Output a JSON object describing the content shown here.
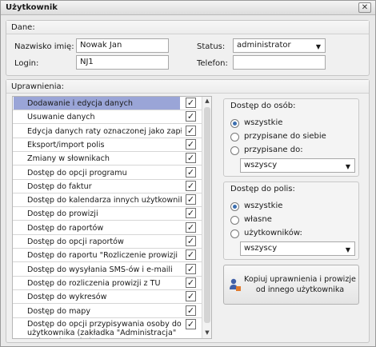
{
  "window": {
    "title": "Użytkownik",
    "close_glyph": "✕"
  },
  "dane": {
    "header": "Dane:",
    "name_label": "Nazwisko imię:",
    "name_value": "Nowak Jan",
    "login_label": "Login:",
    "login_value": "NJ1",
    "status_label": "Status:",
    "status_value": "administrator",
    "phone_label": "Telefon:",
    "phone_value": ""
  },
  "uprawnienia": {
    "header": "Uprawnienia:",
    "items": [
      {
        "label": "Dodawanie i edycja danych",
        "checked": true,
        "selected": true
      },
      {
        "label": "Usuwanie danych",
        "checked": true
      },
      {
        "label": "Edycja danych raty oznaczonej jako zapłacona",
        "checked": true
      },
      {
        "label": "Eksport/import polis",
        "checked": true
      },
      {
        "label": "Zmiany w słownikach",
        "checked": true
      },
      {
        "label": "Dostęp do opcji programu",
        "checked": true
      },
      {
        "label": "Dostęp do faktur",
        "checked": true
      },
      {
        "label": "Dostęp do kalendarza innych użytkowników",
        "checked": true
      },
      {
        "label": "Dostęp do prowizji",
        "checked": true
      },
      {
        "label": "Dostęp do raportów",
        "checked": true
      },
      {
        "label": "Dostęp do opcji raportów",
        "checked": true
      },
      {
        "label": "Dostęp do raportu \"Rozliczenie prowizji",
        "checked": true
      },
      {
        "label": "Dostęp do wysyłania SMS-ów i e-maili",
        "checked": true
      },
      {
        "label": "Dostęp do rozliczenia prowizji z TU",
        "checked": true
      },
      {
        "label": "Dostęp do wykresów",
        "checked": true
      },
      {
        "label": "Dostęp do mapy",
        "checked": true
      },
      {
        "label": "Dostęp do opcji przypisywania osoby do użytkownika (zakładka \"Administracja\" w danych osoby)",
        "checked": true
      }
    ],
    "check_glyph": "✓"
  },
  "dostep_osob": {
    "title": "Dostęp do osób:",
    "options": [
      {
        "label": "wszystkie",
        "checked": true
      },
      {
        "label": "przypisane do siebie",
        "checked": false
      },
      {
        "label": "przypisane do:",
        "checked": false
      }
    ],
    "select_value": "wszyscy"
  },
  "dostep_polis": {
    "title": "Dostęp do polis:",
    "options": [
      {
        "label": "wszystkie",
        "checked": true
      },
      {
        "label": "własne",
        "checked": false
      },
      {
        "label": "użytkowników:",
        "checked": false
      }
    ],
    "select_value": "wszyscy"
  },
  "copy_button": {
    "label": "Kopiuj uprawnienia i prowizje od innego użytkownika",
    "icon": "user-copy-icon"
  },
  "glyphs": {
    "dropdown": "▼",
    "scroll_up": "▲",
    "scroll_down": "▼"
  }
}
